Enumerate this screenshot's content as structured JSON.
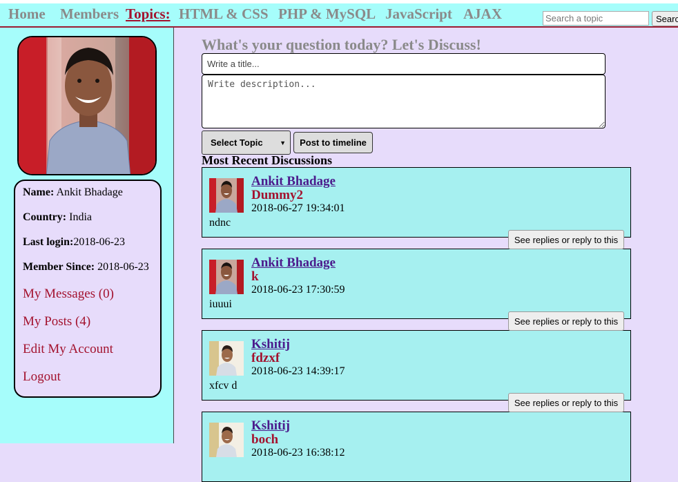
{
  "nav": {
    "items": [
      {
        "label": "Home",
        "active": false
      },
      {
        "label": "Members",
        "active": false
      },
      {
        "label": "Topics:",
        "active": true
      },
      {
        "label": "HTML & CSS",
        "active": false
      },
      {
        "label": "PHP & MySQL",
        "active": false
      },
      {
        "label": "JavaScript",
        "active": false
      },
      {
        "label": "AJAX",
        "active": false
      }
    ],
    "search_placeholder": "Search a topic",
    "search_button": "Search"
  },
  "profile": {
    "name_label": "Name:",
    "name": "Ankit Bhadage",
    "country_label": "Country:",
    "country": "India",
    "last_login_label": "Last login:",
    "last_login": "2018-06-23",
    "member_since_label": "Member Since:",
    "member_since": "2018-06-23",
    "links": [
      "My Messages (0)",
      "My Posts (4)",
      "Edit My Account",
      "Logout"
    ]
  },
  "composer": {
    "heading": "What's your question today? Let's Discuss!",
    "title_placeholder": "Write a title...",
    "description_placeholder": "Write description...",
    "topic_select": "Select Topic",
    "post_button": "Post to timeline"
  },
  "discussions": {
    "title": "Most Recent Discussions",
    "reply_label": "See replies or reply to this",
    "posts": [
      {
        "author": "Ankit Bhadage",
        "title": "Dummy2",
        "time": "2018-06-27 19:34:01",
        "body": "ndnc",
        "avatar": "ankit-avatar"
      },
      {
        "author": "Ankit Bhadage",
        "title": "k",
        "time": "2018-06-23 17:30:59",
        "body": "iuuui",
        "avatar": "ankit-avatar"
      },
      {
        "author": "Kshitij",
        "title": "fdzxf",
        "time": "2018-06-23 14:39:17",
        "body": "xfcv d",
        "avatar": "kshitij-avatar"
      },
      {
        "author": "Kshitij",
        "title": "boch",
        "time": "2018-06-23 16:38:12",
        "body": "",
        "avatar": "kshitij-avatar"
      }
    ]
  },
  "colors": {
    "accent": "#a3122e",
    "panel": "#a6fdfb",
    "card": "#a6f0f0",
    "background": "#e7dcfb",
    "link": "#4b1a8c"
  }
}
